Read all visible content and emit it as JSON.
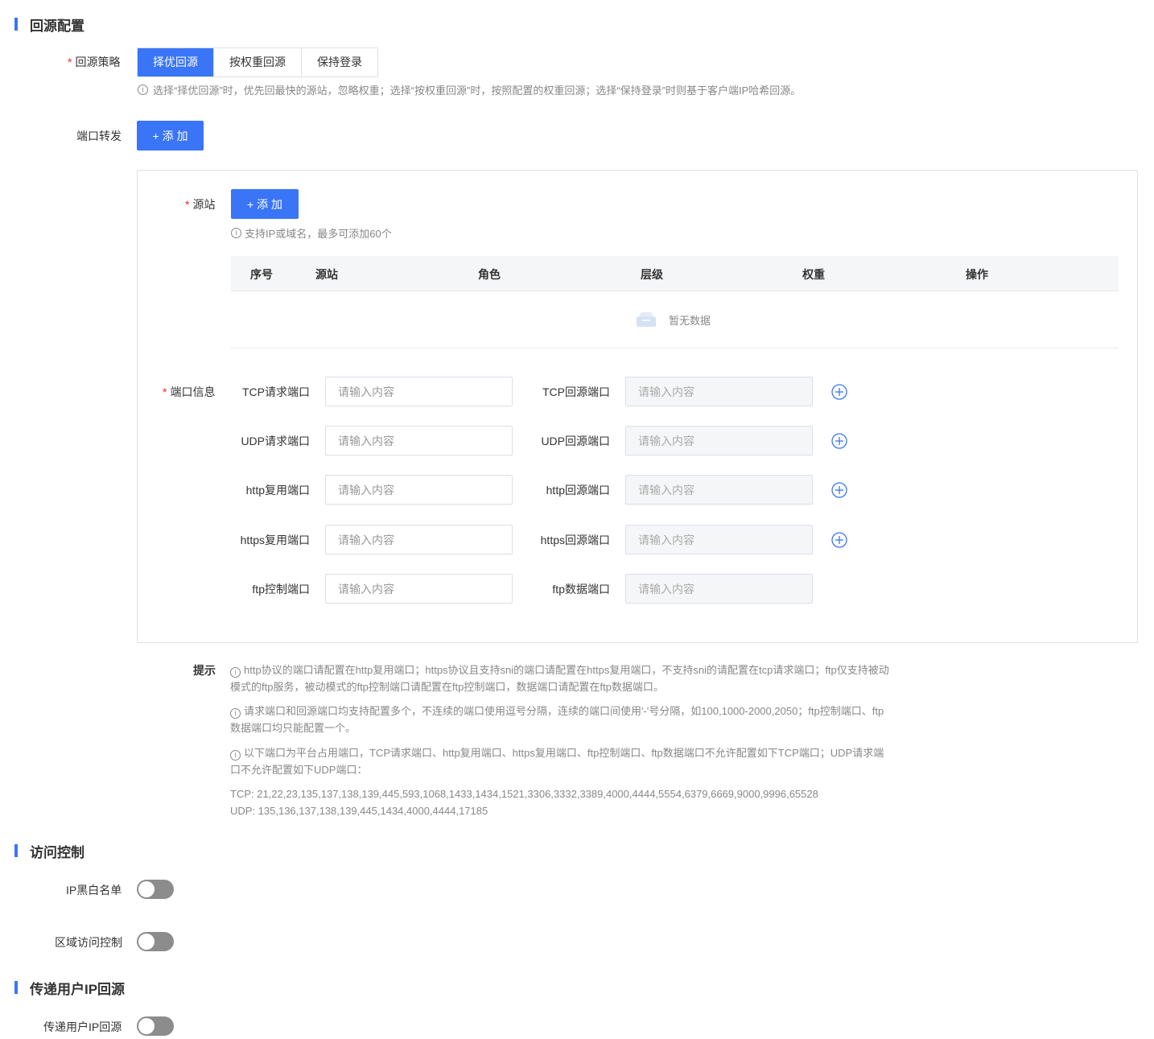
{
  "sections": {
    "origin": "回源配置",
    "access": "访问控制",
    "client_ip": "传递用户IP回源"
  },
  "origin": {
    "strategy_label": "回源策略",
    "strategy_options": [
      "择优回源",
      "按权重回源",
      "保持登录"
    ],
    "strategy_selected": "择优回源",
    "strategy_hint": "选择“择优回源”时，优先回最快的源站，忽略权重；选择“按权重回源”时，按照配置的权重回源；选择“保持登录”时则基于客户端IP哈希回源。",
    "port_forward_label": "端口转发",
    "add_label": "+ 添 加",
    "source_label": "源站",
    "source_add_label": "+ 添 加",
    "source_hint": "支持IP或域名，最多可添加60个",
    "table": {
      "columns": [
        "序号",
        "源站",
        "角色",
        "层级",
        "权重",
        "操作"
      ],
      "empty_text": "暂无数据"
    },
    "port_info_label": "端口信息",
    "placeholder": "请输入内容",
    "port_rows": [
      {
        "left": "TCP请求端口",
        "right": "TCP回源端口"
      },
      {
        "left": "UDP请求端口",
        "right": "UDP回源端口"
      },
      {
        "left": "http复用端口",
        "right": "http回源端口"
      },
      {
        "left": "https复用端口",
        "right": "https回源端口"
      },
      {
        "left": "ftp控制端口",
        "right": "ftp数据端口"
      }
    ],
    "tips_label": "提示",
    "tips": [
      "http协议的端口请配置在http复用端口；https协议且支持sni的端口请配置在https复用端口，不支持sni的请配置在tcp请求端口；ftp仅支持被动模式的ftp服务，被动模式的ftp控制端口请配置在ftp控制端口，数据端口请配置在ftp数据端口。",
      "请求端口和回源端口均支持配置多个，不连续的端口使用逗号分隔，连续的端口间使用'-'号分隔，如100,1000-2000,2050；ftp控制端口、ftp数据端口均只能配置一个。",
      "以下端口为平台占用端口，TCP请求端口、http复用端口、https复用端口、ftp控制端口、ftp数据端口不允许配置如下TCP端口；UDP请求端口不允许配置如下UDP端口："
    ],
    "tcp_ports": "TCP: 21,22,23,135,137,138,139,445,593,1068,1433,1434,1521,3306,3332,3389,4000,4444,5554,6379,6669,9000,9996,65528",
    "udp_ports": "UDP: 135,136,137,138,139,445,1434,4000,4444,17185"
  },
  "access": {
    "ip_list_label": "IP黑白名单",
    "ip_list_enabled": false,
    "region_label": "区域访问控制",
    "region_enabled": false
  },
  "client_ip": {
    "label": "传递用户IP回源",
    "enabled": false
  },
  "colors": {
    "primary": "#3a75f7",
    "switch_off": "#8c8c8c",
    "required": "#f5222d"
  }
}
